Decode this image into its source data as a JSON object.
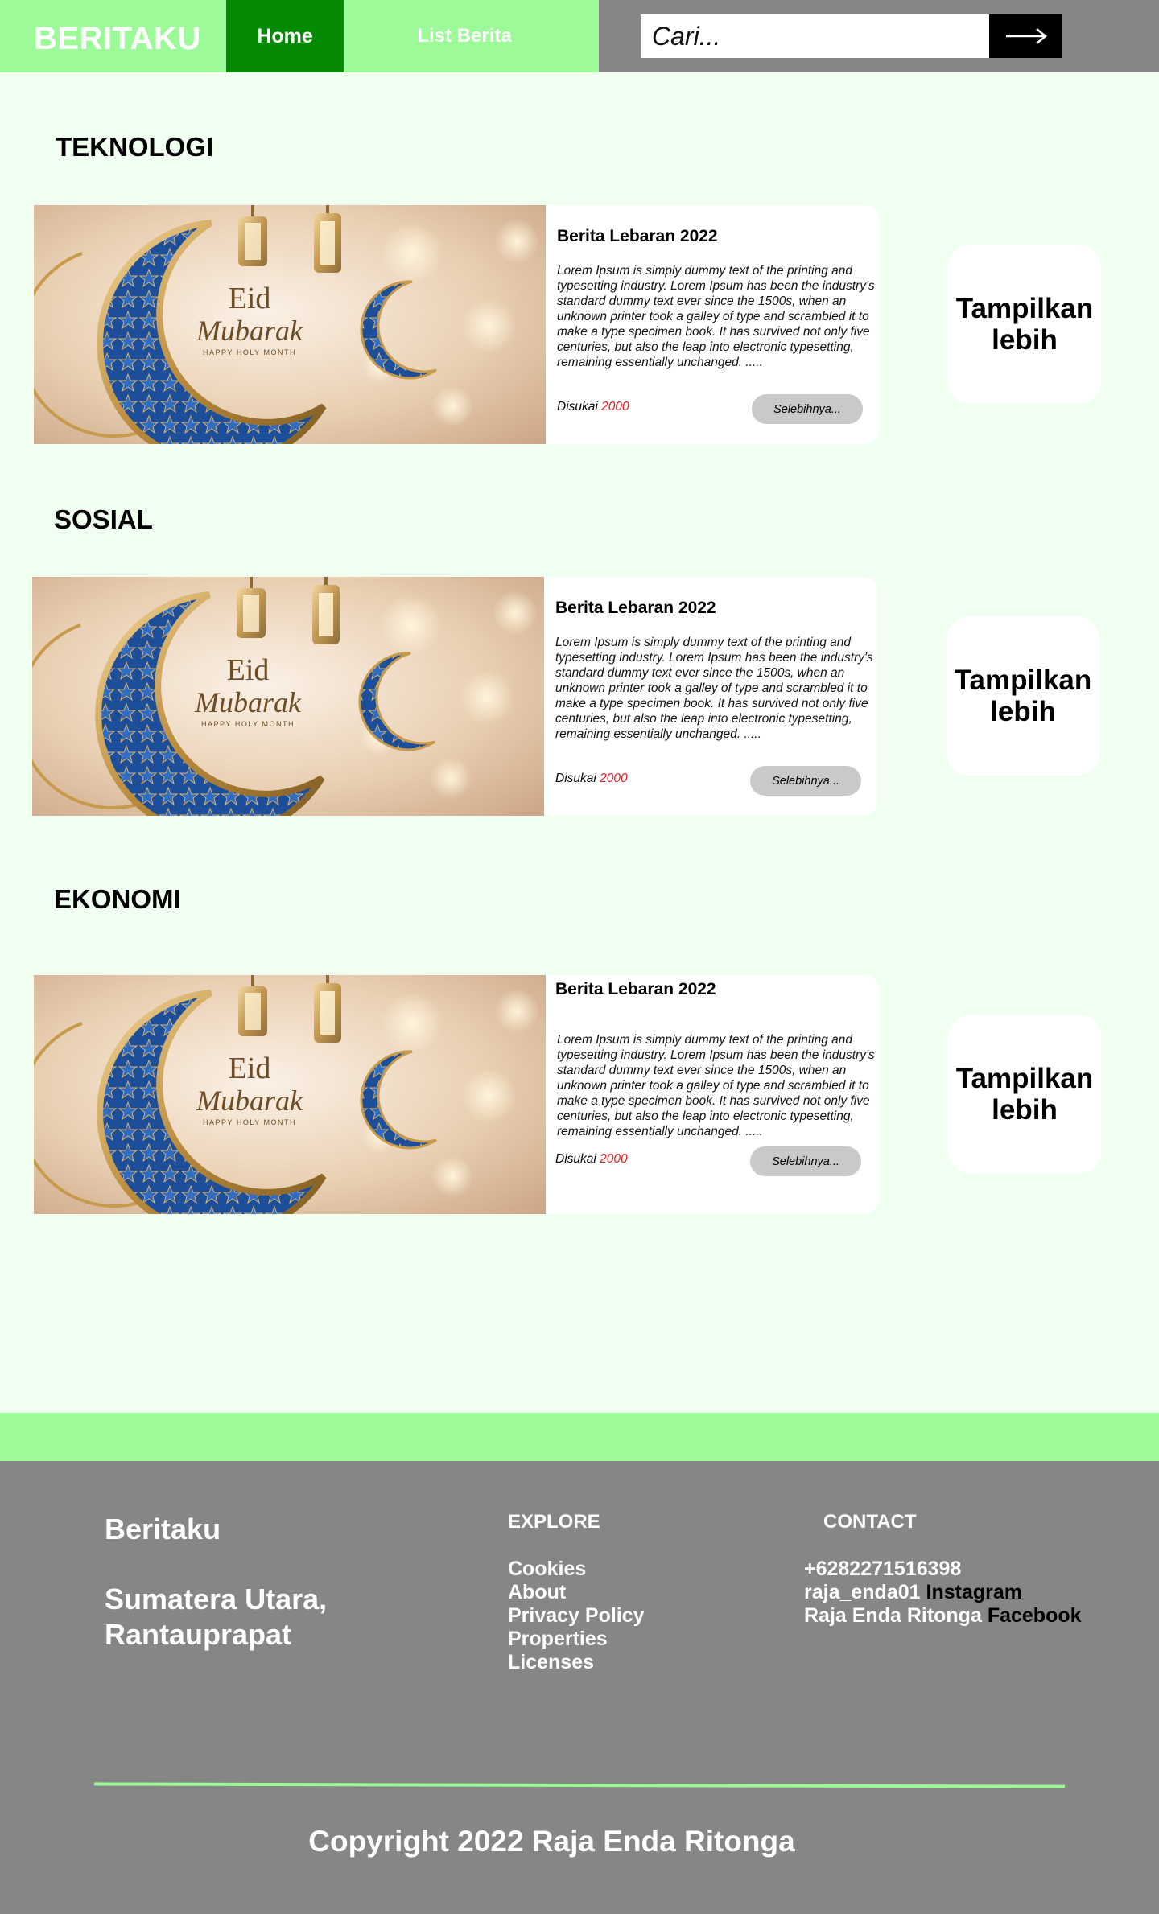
{
  "navbar": {
    "brand": "BERITAKU",
    "home_label": "Home",
    "list_label": "List Berita",
    "search_placeholder": "Cari..."
  },
  "sections": [
    {
      "title": "TEKNOLOGI",
      "card": {
        "title": "Berita Lebaran 2022",
        "text": "Lorem Ipsum is simply dummy text of the printing and typesetting industry. Lorem Ipsum has been the industry's standard dummy text ever since the 1500s, when an unknown printer took a galley of type and scrambled it to make a type specimen book. It has survived not only five centuries, but also the leap into electronic typesetting, remaining essentially unchanged. .....",
        "liked_label": "Disukai",
        "liked_count": "2000",
        "more_label": "Selebihnya..."
      },
      "show_more": "Tampilkan lebih"
    },
    {
      "title": "SOSIAL",
      "card": {
        "title": "Berita Lebaran 2022",
        "text": "Lorem Ipsum is simply dummy text of the printing and typesetting industry. Lorem Ipsum has been the industry's standard dummy text ever since the 1500s, when an unknown printer took a galley of type and scrambled it to make a type specimen book. It has survived not only five centuries, but also the leap into electronic typesetting, remaining essentially unchanged. .....",
        "liked_label": "Disukai",
        "liked_count": "2000",
        "more_label": "Selebihnya..."
      },
      "show_more": "Tampilkan lebih"
    },
    {
      "title": "EKONOMI",
      "card": {
        "title": "Berita Lebaran 2022",
        "text": "Lorem Ipsum is simply dummy text of the printing and typesetting industry. Lorem Ipsum has been the industry's standard dummy text ever since the 1500s, when an unknown printer took a galley of type and scrambled it to make a type specimen book. It has survived not only five centuries, but also the leap into electronic typesetting, remaining essentially unchanged. .....",
        "liked_label": "Disukai",
        "liked_count": "2000",
        "more_label": "Selebihnya..."
      },
      "show_more": "Tampilkan lebih"
    }
  ],
  "image": {
    "line1": "Eid",
    "line2": "Mubarak",
    "line3": "HAPPY HOLY MONTH"
  },
  "footer": {
    "brand": "Beritaku",
    "address": "Sumatera Utara, Rantauprapat",
    "explore_heading": "EXPLORE",
    "explore_links": [
      "Cookies",
      "About",
      "Privacy Policy",
      "Properties",
      "Licenses"
    ],
    "contact_heading": "CONTACT",
    "phone": "+6282271516398",
    "instagram_handle": "raja_enda01",
    "instagram_label": "Instagram",
    "facebook_handle": "Raja Enda Ritonga",
    "facebook_label": "Facebook",
    "copyright": "Copyright 2022 Raja Enda Ritonga"
  },
  "colors": {
    "nav_green": "#9cfb98",
    "home_green": "#058a05",
    "page_bg": "#f0fff0",
    "footer_gray": "#868686",
    "like_count_red": "#e02020"
  }
}
